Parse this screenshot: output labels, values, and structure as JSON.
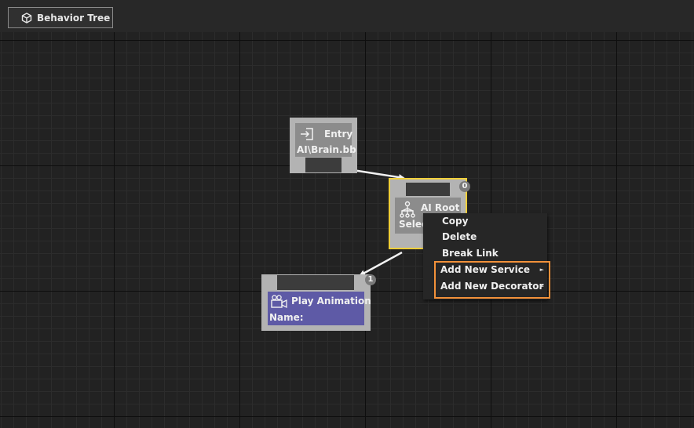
{
  "window": {
    "tab_label": "Behavior Tree",
    "tab_icon": "cube-icon"
  },
  "nodes": {
    "entry": {
      "title": "Entry",
      "subtitle": "AI\\Brain.bb",
      "icon": "entry-icon"
    },
    "root": {
      "title": "AI Root",
      "subtitle": "Selec",
      "icon": "tree-hierarchy-icon",
      "badge": "0",
      "border_color": "#f0cf3a"
    },
    "play_animation": {
      "title": "Play Animation",
      "subtitle": "Name:",
      "icon": "camera-icon",
      "badge": "1",
      "color": "#5e5aa6"
    }
  },
  "context_menu": {
    "items": [
      {
        "label": "Copy",
        "has_submenu": false
      },
      {
        "label": "Delete",
        "has_submenu": false
      },
      {
        "label": "Break Link",
        "has_submenu": false
      },
      {
        "label": "Add New Service",
        "has_submenu": true
      },
      {
        "label": "Add New Decorator",
        "has_submenu": true
      }
    ],
    "highlight_color": "#f2913a"
  }
}
